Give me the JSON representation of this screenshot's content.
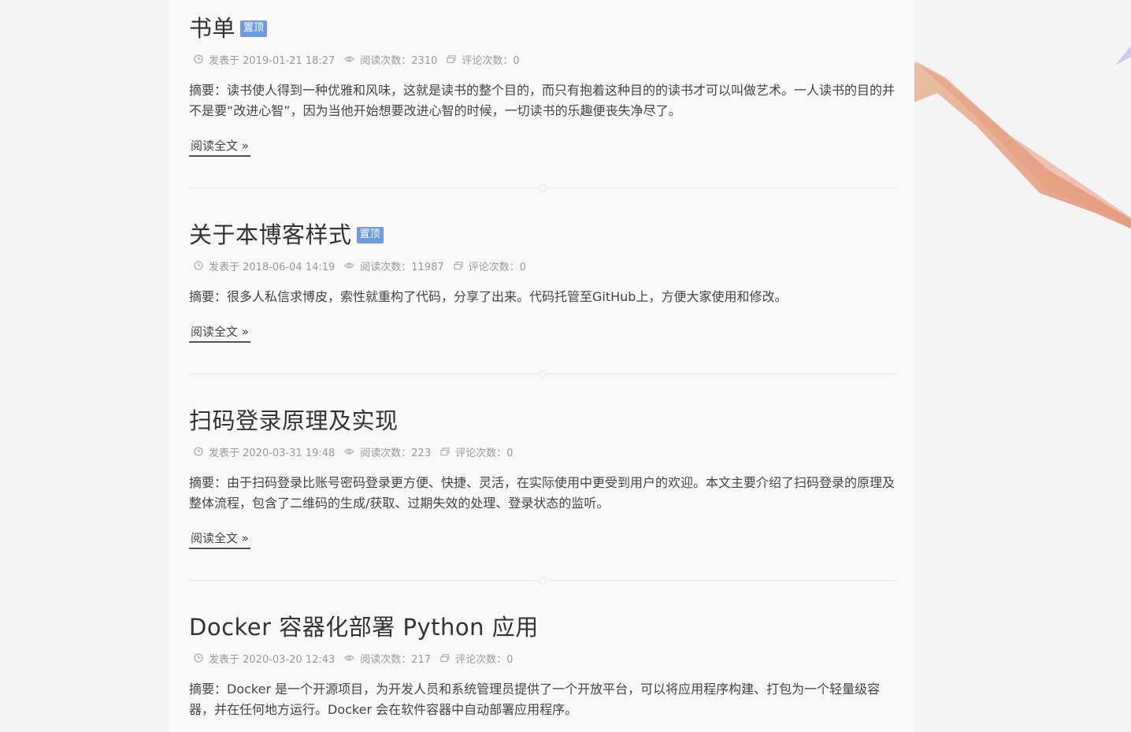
{
  "posts": [
    {
      "title": "书单",
      "pinned_label": "置顶",
      "published": "发表于 2019-01-21 18:27",
      "views": "阅读次数：2310",
      "comments": "评论次数：0",
      "summary": "摘要：读书使人得到一种优雅和风味，这就是读书的整个目的，而只有抱着这种目的的读书才可以叫做艺术。一人读书的目的并不是要“改进心智”，因为当他开始想要改进心智的时候，一切读书的乐趣便丧失净尽了。",
      "read_more": "阅读全文 »"
    },
    {
      "title": "关于本博客样式",
      "pinned_label": "置顶",
      "published": "发表于 2018-06-04 14:19",
      "views": "阅读次数：11987",
      "comments": "评论次数：0",
      "summary": "摘要：很多人私信求博皮，索性就重构了代码，分享了出来。代码托管至GitHub上，方便大家使用和修改。",
      "read_more": "阅读全文 »"
    },
    {
      "title": "扫码登录原理及实现",
      "published": "发表于 2020-03-31 19:48",
      "views": "阅读次数：223",
      "comments": "评论次数：0",
      "summary": "摘要：由于扫码登录比账号密码登录更方便、快捷、灵活，在实际使用中更受到用户的欢迎。本文主要介绍了扫码登录的原理及整体流程，包含了二维码的生成/获取、过期失效的处理、登录状态的监听。",
      "read_more": "阅读全文 »"
    },
    {
      "title": "Docker 容器化部署 Python 应用",
      "published": "发表于 2020-03-20 12:43",
      "views": "阅读次数：217",
      "comments": "评论次数：0",
      "summary": "摘要：Docker 是一个开源项目，为开发人员和系统管理员提供了一个开放平台，可以将应用程序构建、打包为一个轻量级容器，并在任何地方运行。Docker 会在软件容器中自动部署应用程序。"
    }
  ],
  "icons": {
    "published": "clock-icon",
    "views": "eye-icon",
    "comments": "comment-icon"
  },
  "colors": {
    "pinned_badge": "#6d9ce4",
    "background": "#f4f4f4",
    "content_background": "#f9f9f9"
  }
}
